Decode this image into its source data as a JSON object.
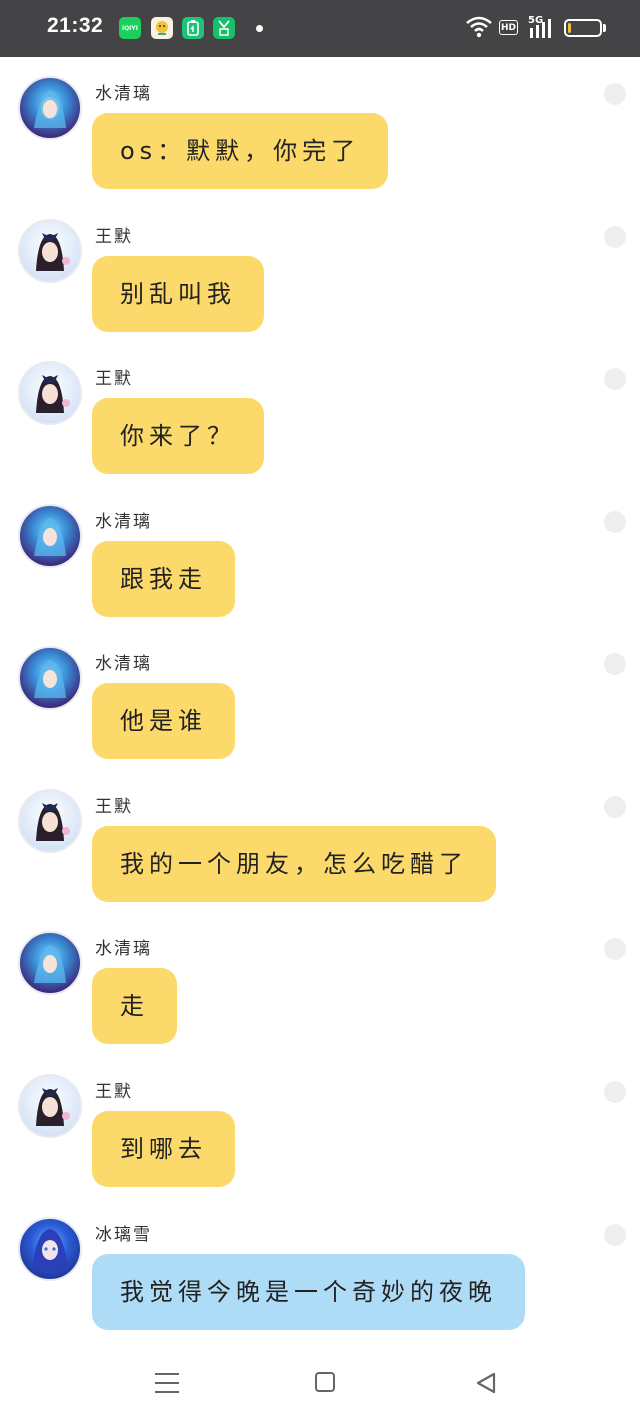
{
  "status_bar": {
    "time": "21:32",
    "apps": [
      {
        "icon": "iqiyi-icon",
        "label": "iQIYI",
        "color": "#1ccf5a"
      },
      {
        "icon": "app-icon-avatar",
        "label": "",
        "color": "#f5f5f5"
      },
      {
        "icon": "app-icon-green-box",
        "label": "",
        "color": "#20c27a"
      },
      {
        "icon": "app-icon-green-y",
        "label": "",
        "color": "#15c26a"
      }
    ],
    "hd_label": "HD",
    "network_label": "5G",
    "battery_level": 0.1
  },
  "messages": [
    {
      "sender": "水清璃",
      "text": "os：默默，你完了",
      "avatar": "shui-qingli-avatar",
      "bubble_color": "yellow"
    },
    {
      "sender": "王默",
      "text": "别乱叫我",
      "avatar": "wang-mo-avatar",
      "bubble_color": "yellow"
    },
    {
      "sender": "王默",
      "text": "你来了？",
      "avatar": "wang-mo-avatar",
      "bubble_color": "yellow"
    },
    {
      "sender": "水清璃",
      "text": "跟我走",
      "avatar": "shui-qingli-avatar",
      "bubble_color": "yellow"
    },
    {
      "sender": "水清璃",
      "text": "他是谁",
      "avatar": "shui-qingli-avatar",
      "bubble_color": "yellow"
    },
    {
      "sender": "王默",
      "text": "我的一个朋友，怎么吃醋了",
      "avatar": "wang-mo-avatar",
      "bubble_color": "yellow"
    },
    {
      "sender": "水清璃",
      "text": "走",
      "avatar": "shui-qingli-avatar",
      "bubble_color": "yellow"
    },
    {
      "sender": "王默",
      "text": "到哪去",
      "avatar": "wang-mo-avatar",
      "bubble_color": "yellow"
    },
    {
      "sender": "冰璃雪",
      "text": "我觉得今晚是一个奇妙的夜晚",
      "avatar": "bing-lixue-avatar",
      "bubble_color": "blue"
    }
  ],
  "nav_bar": {
    "menu_icon": "menu-icon",
    "home_icon": "home-icon",
    "back_icon": "back-icon"
  }
}
